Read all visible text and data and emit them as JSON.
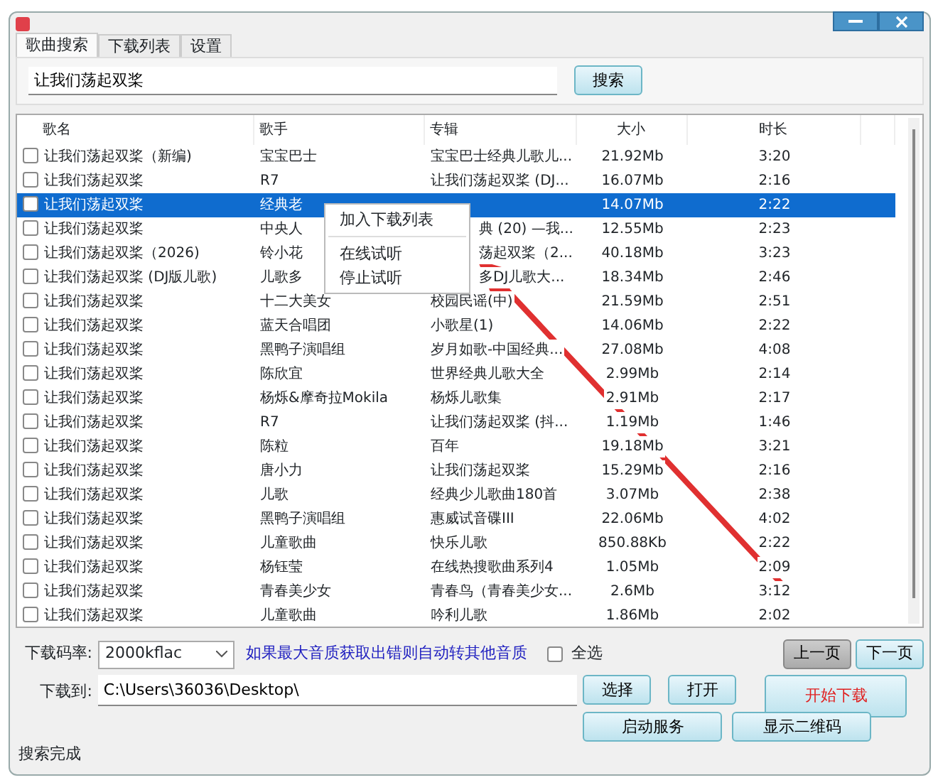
{
  "tabs": [
    {
      "label": "歌曲搜索",
      "selected": true
    },
    {
      "label": "下载列表",
      "selected": false
    },
    {
      "label": "设置",
      "selected": false
    }
  ],
  "search": {
    "value": "让我们荡起双桨",
    "button": "搜索"
  },
  "table": {
    "columns": [
      "歌名",
      "歌手",
      "专辑",
      "大小",
      "时长"
    ],
    "rows": [
      {
        "checked": false,
        "selected": false,
        "cells": [
          "让我们荡起双桨（新编)",
          "宝宝巴士",
          "宝宝巴士经典儿歌儿...",
          "21.92Mb",
          "3:20"
        ]
      },
      {
        "checked": false,
        "selected": false,
        "cells": [
          "让我们荡起双桨",
          "R7",
          "让我们荡起双桨 (DJ...",
          "16.07Mb",
          "2:16"
        ]
      },
      {
        "checked": false,
        "selected": true,
        "cells": [
          "让我们荡起双桨",
          "经典老",
          "",
          "14.07Mb",
          "2:22"
        ]
      },
      {
        "checked": false,
        "selected": false,
        "cells": [
          "让我们荡起双桨",
          "中央人",
          "典 (20) —我...",
          "12.55Mb",
          "2:23"
        ]
      },
      {
        "checked": false,
        "selected": false,
        "cells": [
          "让我们荡起双桨（2026)",
          "铃小花",
          "荡起双桨（2...",
          "40.18Mb",
          "3:23"
        ]
      },
      {
        "checked": false,
        "selected": false,
        "cells": [
          "让我们荡起双桨 (DJ版儿歌)",
          "儿歌多",
          "多DJ儿歌大...",
          "18.34Mb",
          "2:46"
        ]
      },
      {
        "checked": false,
        "selected": false,
        "cells": [
          "让我们荡起双桨",
          "十二大美女",
          "校园民谣(中)",
          "21.59Mb",
          "2:51"
        ]
      },
      {
        "checked": false,
        "selected": false,
        "cells": [
          "让我们荡起双桨",
          "蓝天合唱团",
          "小歌星(1)",
          "14.06Mb",
          "2:22"
        ]
      },
      {
        "checked": false,
        "selected": false,
        "cells": [
          "让我们荡起双桨",
          "黑鸭子演唱组",
          "岁月如歌-中国经典...",
          "27.08Mb",
          "4:08"
        ]
      },
      {
        "checked": false,
        "selected": false,
        "cells": [
          "让我们荡起双桨",
          "陈欣宜",
          "世界经典儿歌大全",
          "2.99Mb",
          "2:14"
        ]
      },
      {
        "checked": false,
        "selected": false,
        "cells": [
          "让我们荡起双桨",
          "杨烁&摩奇拉Mokila",
          "杨烁儿歌集",
          "2.91Mb",
          "2:17"
        ]
      },
      {
        "checked": false,
        "selected": false,
        "cells": [
          "让我们荡起双桨",
          "R7",
          "让我们荡起双桨 (抖...",
          "1.19Mb",
          "1:46"
        ]
      },
      {
        "checked": false,
        "selected": false,
        "cells": [
          "让我们荡起双桨",
          "陈粒",
          "百年",
          "19.18Mb",
          "3:21"
        ]
      },
      {
        "checked": false,
        "selected": false,
        "cells": [
          "让我们荡起双桨",
          "唐小力",
          "让我们荡起双桨",
          "15.29Mb",
          "2:16"
        ]
      },
      {
        "checked": false,
        "selected": false,
        "cells": [
          "让我们荡起双桨",
          "儿歌",
          "经典少儿歌曲180首",
          "3.07Mb",
          "2:38"
        ]
      },
      {
        "checked": false,
        "selected": false,
        "cells": [
          "让我们荡起双桨",
          "黑鸭子演唱组",
          "惠威试音碟III",
          "22.06Mb",
          "4:02"
        ]
      },
      {
        "checked": false,
        "selected": false,
        "cells": [
          "让我们荡起双桨",
          "儿童歌曲",
          "快乐儿歌",
          "850.88Kb",
          "2:22"
        ]
      },
      {
        "checked": false,
        "selected": false,
        "cells": [
          "让我们荡起双桨",
          "杨钰莹",
          "在线热搜歌曲系列4",
          "1.05Mb",
          "2:09"
        ]
      },
      {
        "checked": false,
        "selected": false,
        "cells": [
          "让我们荡起双桨",
          "青春美少女",
          "青春鸟（青春美少女...",
          "2.6Mb",
          "3:12"
        ]
      },
      {
        "checked": false,
        "selected": false,
        "cells": [
          "让我们荡起双桨",
          "儿童歌曲",
          "吟利儿歌",
          "1.86Mb",
          "2:02"
        ]
      }
    ]
  },
  "context_menu": [
    {
      "kind": "item",
      "label": "加入下载列表"
    },
    {
      "kind": "separator"
    },
    {
      "kind": "item",
      "label": "在线试听"
    },
    {
      "kind": "item",
      "label": "停止试听"
    }
  ],
  "bitrate": {
    "label": "下载码率:",
    "value": "2000kflac",
    "hint": "如果最大音质获取出错则自动转其他音质"
  },
  "select_all": {
    "label": "全选",
    "checked": false
  },
  "pager": [
    {
      "label": "上一页",
      "pressed": true
    },
    {
      "label": "下一页",
      "pressed": false
    }
  ],
  "download_to": {
    "label": "下载到:",
    "value": "C:\\Users\\36036\\Desktop\\"
  },
  "buttons": [
    {
      "label": "选择",
      "kind": "plain"
    },
    {
      "label": "打开",
      "kind": "plain"
    },
    {
      "label": "开始下载",
      "kind": "start"
    },
    {
      "label": "启动服务",
      "kind": "wide"
    },
    {
      "label": "显示二维码",
      "kind": "wide"
    }
  ],
  "status_bar": "搜索完成"
}
